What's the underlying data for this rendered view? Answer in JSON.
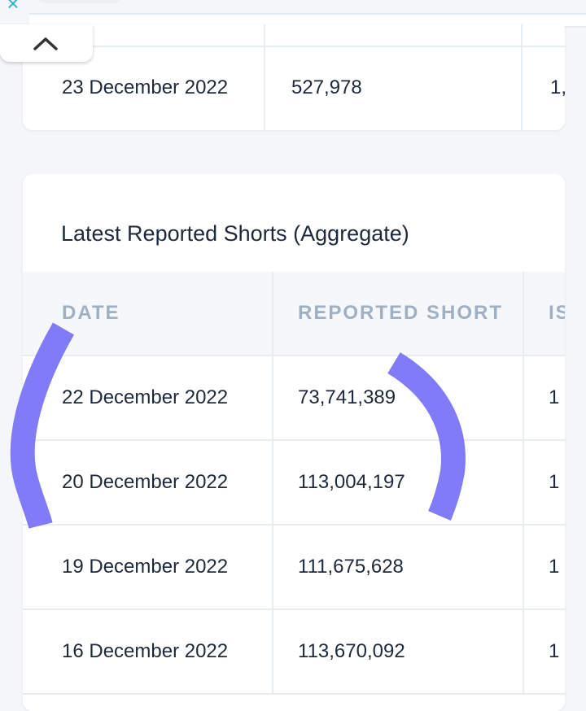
{
  "top_card": {
    "row": {
      "date": "23 December 2022",
      "value": "527,978",
      "cut": "1,"
    }
  },
  "aggregate_card": {
    "title": "Latest Reported Shorts (Aggregate)",
    "columns": [
      "DATE",
      "REPORTED SHORT",
      "IS"
    ],
    "rows": [
      {
        "date": "22 December 2022",
        "value": "73,741,389",
        "cut": "1"
      },
      {
        "date": "20 December 2022",
        "value": "113,004,197",
        "cut": "1"
      },
      {
        "date": "19 December 2022",
        "value": "111,675,628",
        "cut": "1"
      },
      {
        "date": "16 December 2022",
        "value": "113,670,092",
        "cut": "1"
      }
    ]
  },
  "colors": {
    "accent": "#2bb0c7",
    "header_text": "#9fb0c3",
    "text": "#1e2a3b",
    "annotation": "#7b74f7"
  },
  "icons": {
    "close": "close-icon",
    "collapse": "chevron-up-icon"
  },
  "glyphs": {
    "close": "×"
  }
}
